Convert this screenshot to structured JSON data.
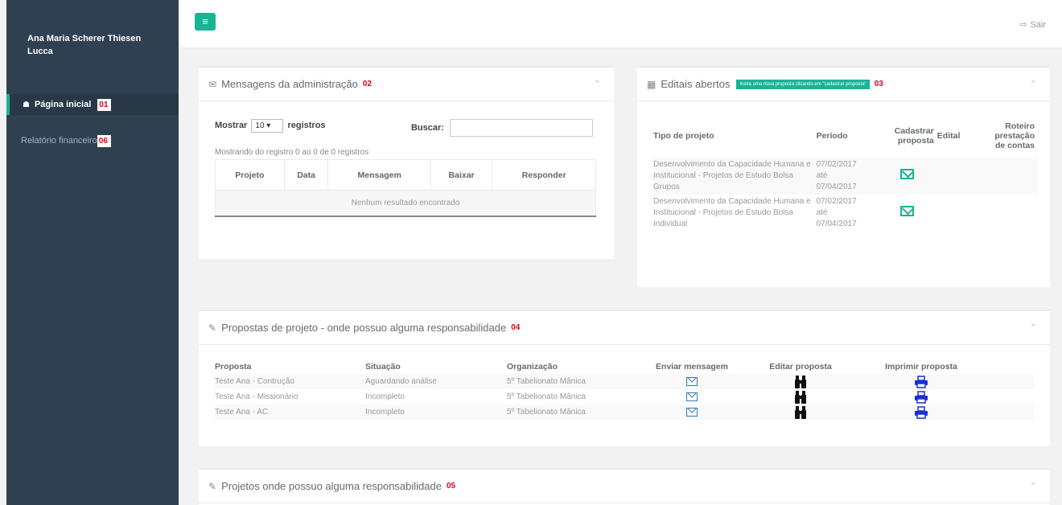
{
  "sidebar": {
    "user_name": "Ana Maria Scherer Thiesen Lucca",
    "items": [
      {
        "label": "Página inicial",
        "tag": "01"
      },
      {
        "label": "Relatório financeiro",
        "tag": "06"
      }
    ]
  },
  "topbar": {
    "menu_icon": "hamburger-icon",
    "logout_label": "Sair"
  },
  "messages": {
    "title": "Mensagens da administração",
    "tag": "02",
    "show_label": "Mostrar",
    "page_size": "10",
    "records_label": "registros",
    "search_label": "Buscar:",
    "search_value": "",
    "info": "Mostrando do registro 0 ao 0 de 0 registros",
    "columns": [
      "Projeto",
      "Data",
      "Mensagem",
      "Baixar",
      "Responder"
    ],
    "empty": "Nenhum resultado encontrado"
  },
  "editais": {
    "title": "Editais abertos",
    "badge": "Insira uma nova proposta clicando em \"cadastrar proposta\"",
    "tag": "03",
    "columns": [
      "Tipo de projeto",
      "Período",
      "Cadastrar proposta",
      "Edital",
      "Roteiro prestação de contas"
    ],
    "rows": [
      {
        "tipo": "Desenvolvimento da Capacidade Humana e Institucional - Projetos de Estudo Bolsa Grupos",
        "periodo_ini": "07/02/2017",
        "ate": "até",
        "periodo_fim": "07/04/2017"
      },
      {
        "tipo": "Desenvolvimento da Capacidade Humana e Institucional - Projetos de Estudo Bolsa Individual",
        "periodo_ini": "07/02/2017",
        "ate": "até",
        "periodo_fim": "07/04/2017"
      }
    ]
  },
  "propostas": {
    "title": "Propostas de projeto - onde possuo alguma responsabilidade",
    "tag": "04",
    "columns": [
      "Proposta",
      "Situação",
      "Organização",
      "Enviar mensagem",
      "Editar proposta",
      "Imprimir proposta"
    ],
    "rows": [
      {
        "proposta": "Teste Ana - Contrução",
        "situacao": "Aguardando análise",
        "organizacao": "5º Tabelionato Mânica"
      },
      {
        "proposta": "Teste Ana - Missionário",
        "situacao": "Incompleto",
        "organizacao": "5º Tabelionato Mânica"
      },
      {
        "proposta": "Teste Ana - AC",
        "situacao": "Incompleto",
        "organizacao": "5º Tabelionato Mânica"
      }
    ]
  },
  "projetos": {
    "title": "Projetos onde possuo alguma responsabilidade",
    "tag": "05"
  },
  "colors": {
    "sidebar_bg": "#2f4050",
    "accent": "#1ab394",
    "tag_red": "#e0001b",
    "link_blue": "#337ab7"
  }
}
